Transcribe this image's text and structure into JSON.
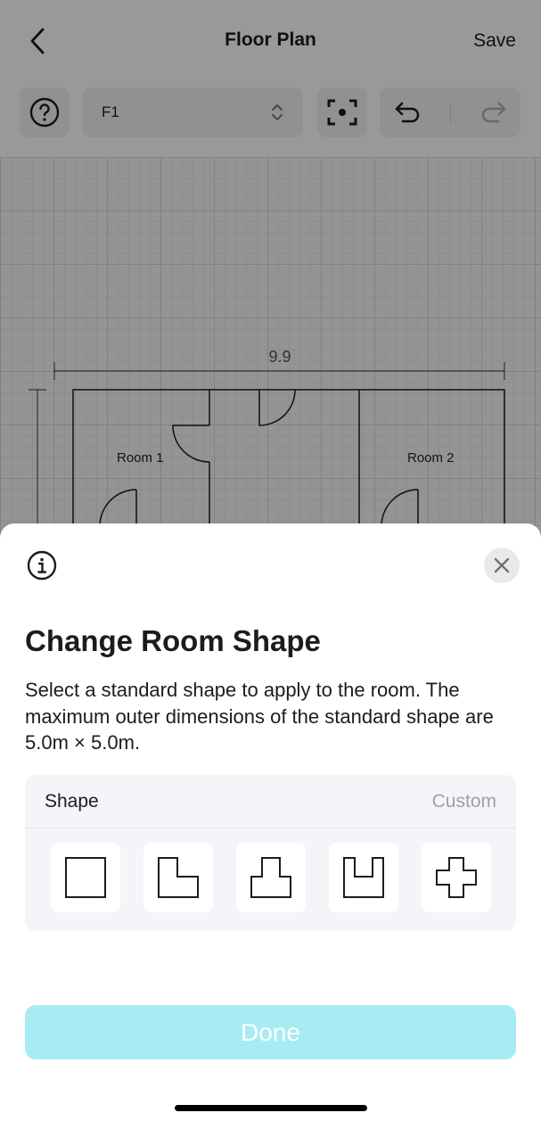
{
  "nav": {
    "title": "Floor Plan",
    "save_label": "Save",
    "back_icon": "chevron-left-icon"
  },
  "toolbar": {
    "help_icon": "question-circle-icon",
    "floor_value": "F1",
    "floor_picker_icon": "chevron-up-down-icon",
    "focus_icon": "focus-frame-icon",
    "undo_icon": "undo-icon",
    "redo_icon": "redo-icon"
  },
  "plan": {
    "dimension_label": "9.9",
    "rooms": [
      "Room 1",
      "Room 2"
    ]
  },
  "sheet": {
    "info_icon": "info-circle-icon",
    "close_icon": "close-icon",
    "title": "Change Room Shape",
    "description": "Select a standard shape to apply to the room. The maximum outer dimensions of the standard shape are 5.0m × 5.0m.",
    "shape": {
      "label": "Shape",
      "value": "Custom",
      "options": [
        "square-shape-icon",
        "l-shape-icon",
        "t-shape-icon",
        "u-shape-icon",
        "cross-shape-icon"
      ]
    },
    "done_label": "Done"
  },
  "colors": {
    "accent_disabled": "#a7ecf4",
    "card_background": "#f4f5f9",
    "overlay": "rgba(0,0,0,0.4)"
  }
}
